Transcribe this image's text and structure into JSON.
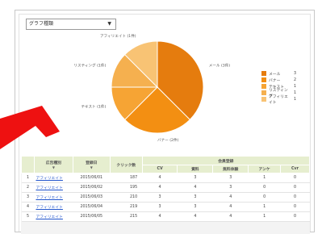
{
  "filter": {
    "selected": "グラフ種類"
  },
  "colors": {
    "accent_red": "#ee1111",
    "header_green": "#e6eecf",
    "link_blue": "#2255cc"
  },
  "chart_data": {
    "type": "pie",
    "slices": [
      {
        "name": "メール",
        "value": 3,
        "color": "#e57c0e"
      },
      {
        "name": "バナー",
        "value": 2,
        "color": "#f38f12"
      },
      {
        "name": "テキスト",
        "value": 1,
        "color": "#f6a434"
      },
      {
        "name": "リスティング",
        "value": 1,
        "color": "#f5b04f"
      },
      {
        "name": "アフィリエイト",
        "value": 1,
        "color": "#f8c374"
      }
    ],
    "slice_labels": [
      "メール (3件)",
      "バナー (2件)",
      "テキスト (1件)",
      "リスティング (1件)",
      "アフィリエイト (1件)"
    ]
  },
  "legend": [
    {
      "label": "メール",
      "count": "3"
    },
    {
      "label": "バナー",
      "count": "2"
    },
    {
      "label": "テキスト",
      "count": "1"
    },
    {
      "label": "リスティング",
      "count": "1"
    },
    {
      "label": "アフィリエイト",
      "count": "1"
    }
  ],
  "table": {
    "group_header": "会員登録",
    "headers": {
      "name": "広告種別",
      "date": "登録日",
      "clicks": "クリック数",
      "cv": "CV",
      "c1": "資料",
      "c2": "無料体験",
      "c3": "アンケ",
      "c4": "Cvr"
    },
    "sort_mark": "▼",
    "rows": [
      {
        "no": "1",
        "name": "アフィリエイト",
        "date": "2015/06/01",
        "clicks": "187",
        "cv": "4",
        "c1": "3",
        "c2": "3",
        "c3": "1",
        "c4": "0"
      },
      {
        "no": "2",
        "name": "アフィリエイト",
        "date": "2015/06/02",
        "clicks": "195",
        "cv": "4",
        "c1": "4",
        "c2": "3",
        "c3": "0",
        "c4": "0"
      },
      {
        "no": "3",
        "name": "アフィリエイト",
        "date": "2015/06/03",
        "clicks": "210",
        "cv": "3",
        "c1": "3",
        "c2": "4",
        "c3": "0",
        "c4": "0"
      },
      {
        "no": "4",
        "name": "アフィリエイト",
        "date": "2015/06/04",
        "clicks": "219",
        "cv": "3",
        "c1": "3",
        "c2": "4",
        "c3": "1",
        "c4": "0"
      },
      {
        "no": "5",
        "name": "アフィリエイト",
        "date": "2015/06/05",
        "clicks": "215",
        "cv": "4",
        "c1": "4",
        "c2": "4",
        "c3": "1",
        "c4": "0"
      }
    ]
  }
}
